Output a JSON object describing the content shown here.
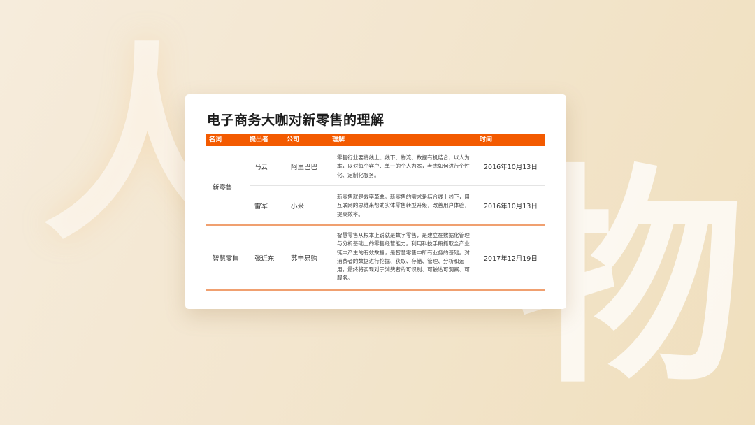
{
  "background": {
    "char_left": "人",
    "char_right": "物"
  },
  "card": {
    "title": "电子商务大咖对新零售的理解"
  },
  "table": {
    "accent_color": "#f35a00",
    "headers": {
      "term": "名词",
      "proposer": "提出者",
      "company": "公司",
      "understanding": "理解",
      "time": "时间"
    },
    "groups": [
      {
        "term": "新零售",
        "rows": [
          {
            "proposer": "马云",
            "company": "阿里巴巴",
            "understanding": "零售行业要将线上、线下、物流、数据有机结合，以人为本，以对每个客户、单一的个人为本，考虑如何进行个性化、定制化服务。",
            "time": "2016年10月13日"
          },
          {
            "proposer": "雷军",
            "company": "小米",
            "understanding": "新零售就是效率革命。新零售的需求是结合线上线下，用互联网的思维来帮助实体零售转型升级，改善用户体验，提高效率。",
            "time": "2016年10月13日"
          }
        ]
      },
      {
        "term": "智慧零售",
        "rows": [
          {
            "proposer": "张近东",
            "company": "苏宁易购",
            "understanding": "智慧零售从根本上说就是数字零售，是建立在数据化管理与分析基础上的零售经营能力。利用科技手段抓取全产业链中产生的有效数据，是智慧零售中所有业务的基础。对消费者的数据进行挖掘、获取、存储、管理、分析和运用，最终将实现对于消费者的可识别、可触达可洞察、可服务。",
            "time": "2017年12月19日"
          }
        ]
      }
    ]
  }
}
